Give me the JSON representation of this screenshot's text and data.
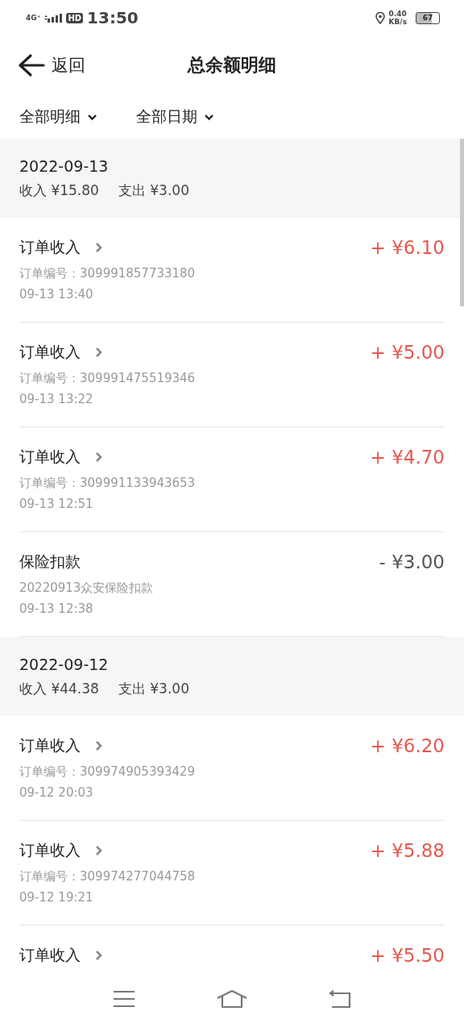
{
  "status_bar": {
    "network": "4G⁺",
    "hd": "HD",
    "time": "13:50",
    "speed_value": "0.40",
    "speed_unit": "KB/s",
    "battery": "67"
  },
  "header": {
    "back_label": "返回",
    "title": "总余额明细"
  },
  "filters": [
    {
      "label": "全部明细"
    },
    {
      "label": "全部日期"
    }
  ],
  "groups": [
    {
      "date": "2022-09-13",
      "income": "收入 ¥15.80",
      "expense": "支出 ¥3.00",
      "entries": [
        {
          "kind": "income",
          "title": "订单收入",
          "detail": "订单编号：309991857733180",
          "time": "09-13 13:40",
          "amount": "+ ¥6.10"
        },
        {
          "kind": "income",
          "title": "订单收入",
          "detail": "订单编号：309991475519346",
          "time": "09-13 13:22",
          "amount": "+ ¥5.00"
        },
        {
          "kind": "income",
          "title": "订单收入",
          "detail": "订单编号：309991133943653",
          "time": "09-13 12:51",
          "amount": "+ ¥4.70"
        },
        {
          "kind": "deduction",
          "title": "保险扣款",
          "detail": "20220913众安保险扣款",
          "time": "09-13 12:38",
          "amount": "- ¥3.00"
        }
      ]
    },
    {
      "date": "2022-09-12",
      "income": "收入 ¥44.38",
      "expense": "支出 ¥3.00",
      "entries": [
        {
          "kind": "income",
          "title": "订单收入",
          "detail": "订单编号：309974905393429",
          "time": "09-12 20:03",
          "amount": "+ ¥6.20"
        },
        {
          "kind": "income",
          "title": "订单收入",
          "detail": "订单编号：309974277044758",
          "time": "09-12 19:21",
          "amount": "+ ¥5.88"
        },
        {
          "kind": "income",
          "title": "订单收入",
          "amount": "+ ¥5.50"
        }
      ]
    }
  ]
}
